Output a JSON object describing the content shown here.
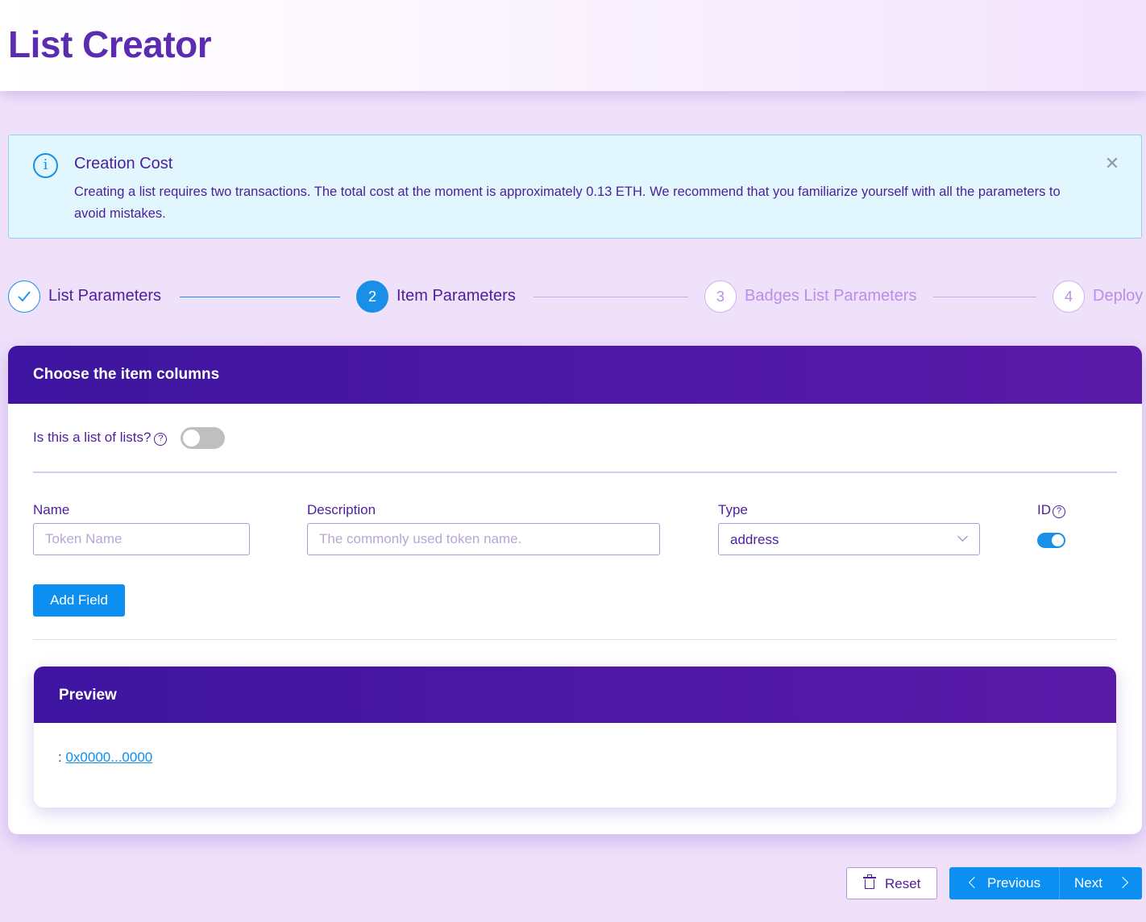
{
  "app": {
    "title": "List Creator"
  },
  "alert": {
    "title": "Creation Cost",
    "message": "Creating a list requires two transactions. The total cost at the moment is approximately 0.13 ETH. We recommend that you familiarize yourself with all the parameters to avoid mistakes.",
    "icon": "info-icon",
    "close_icon": "close-icon"
  },
  "steps": [
    {
      "number": "",
      "label": "List Parameters",
      "status": "completed",
      "icon": "check-icon"
    },
    {
      "number": "2",
      "label": "Item Parameters",
      "status": "active"
    },
    {
      "number": "3",
      "label": "Badges List Parameters",
      "status": "pending"
    },
    {
      "number": "4",
      "label": "Deploy",
      "status": "pending"
    }
  ],
  "card": {
    "title": "Choose the item columns",
    "list_of_lists_label": "Is this a list of lists?",
    "list_of_lists_value": false,
    "fields": {
      "name_label": "Name",
      "name_placeholder": "Token Name",
      "description_label": "Description",
      "description_placeholder": "The commonly used token name.",
      "type_label": "Type",
      "type_value": "address",
      "id_label": "ID",
      "id_value": true
    },
    "add_field_label": "Add Field"
  },
  "preview": {
    "title": "Preview",
    "row_prefix": ":",
    "row_link": "0x0000...0000"
  },
  "footer": {
    "reset_label": "Reset",
    "previous_label": "Previous",
    "next_label": "Next"
  },
  "colors": {
    "primary": "#0c8ff0",
    "brand_purple": "#4d1f9b",
    "header_gradient_start": "#3d15a0",
    "header_gradient_end": "#5a1aa8",
    "alert_bg": "#e1f6fd"
  }
}
